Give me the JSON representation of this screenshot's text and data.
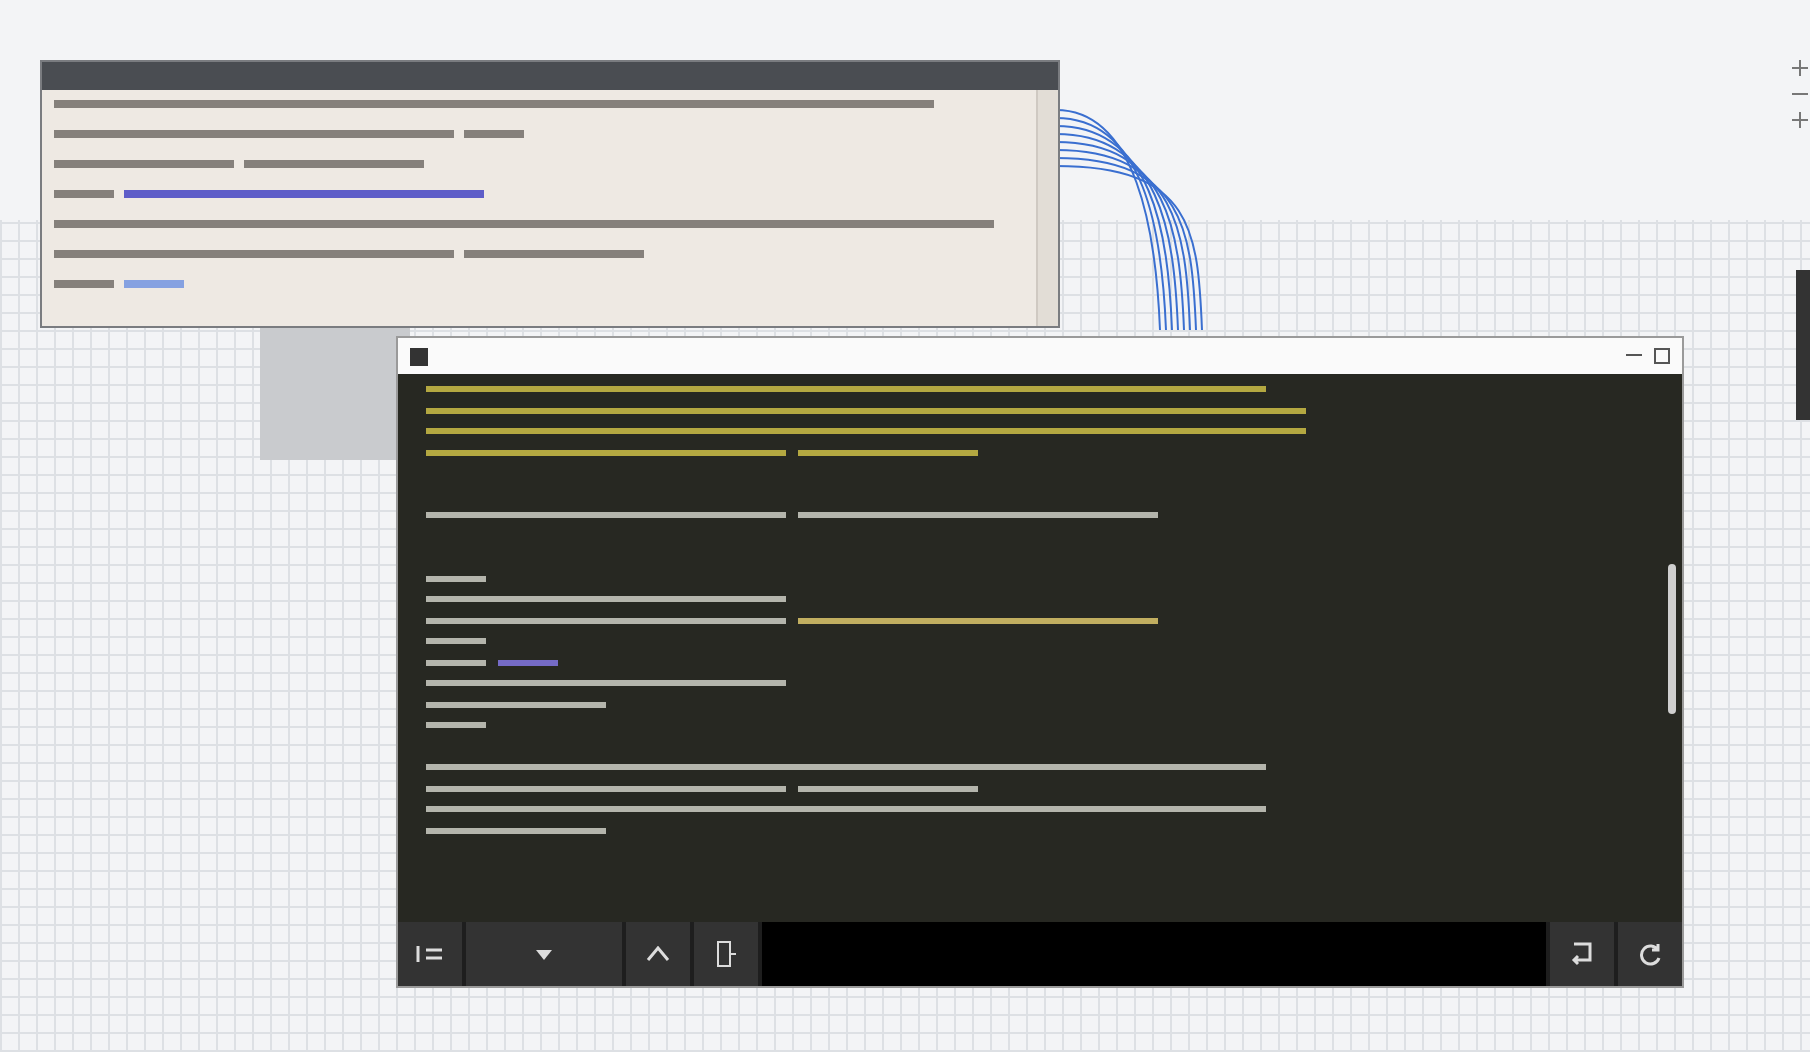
{
  "console": {
    "toolbar": {
      "left": [
        {
          "kind": "menu"
        },
        {
          "kind": "dropdown"
        },
        {
          "kind": "up"
        },
        {
          "kind": "device"
        }
      ],
      "right": [
        {
          "kind": "return"
        },
        {
          "kind": "refresh"
        }
      ]
    }
  }
}
